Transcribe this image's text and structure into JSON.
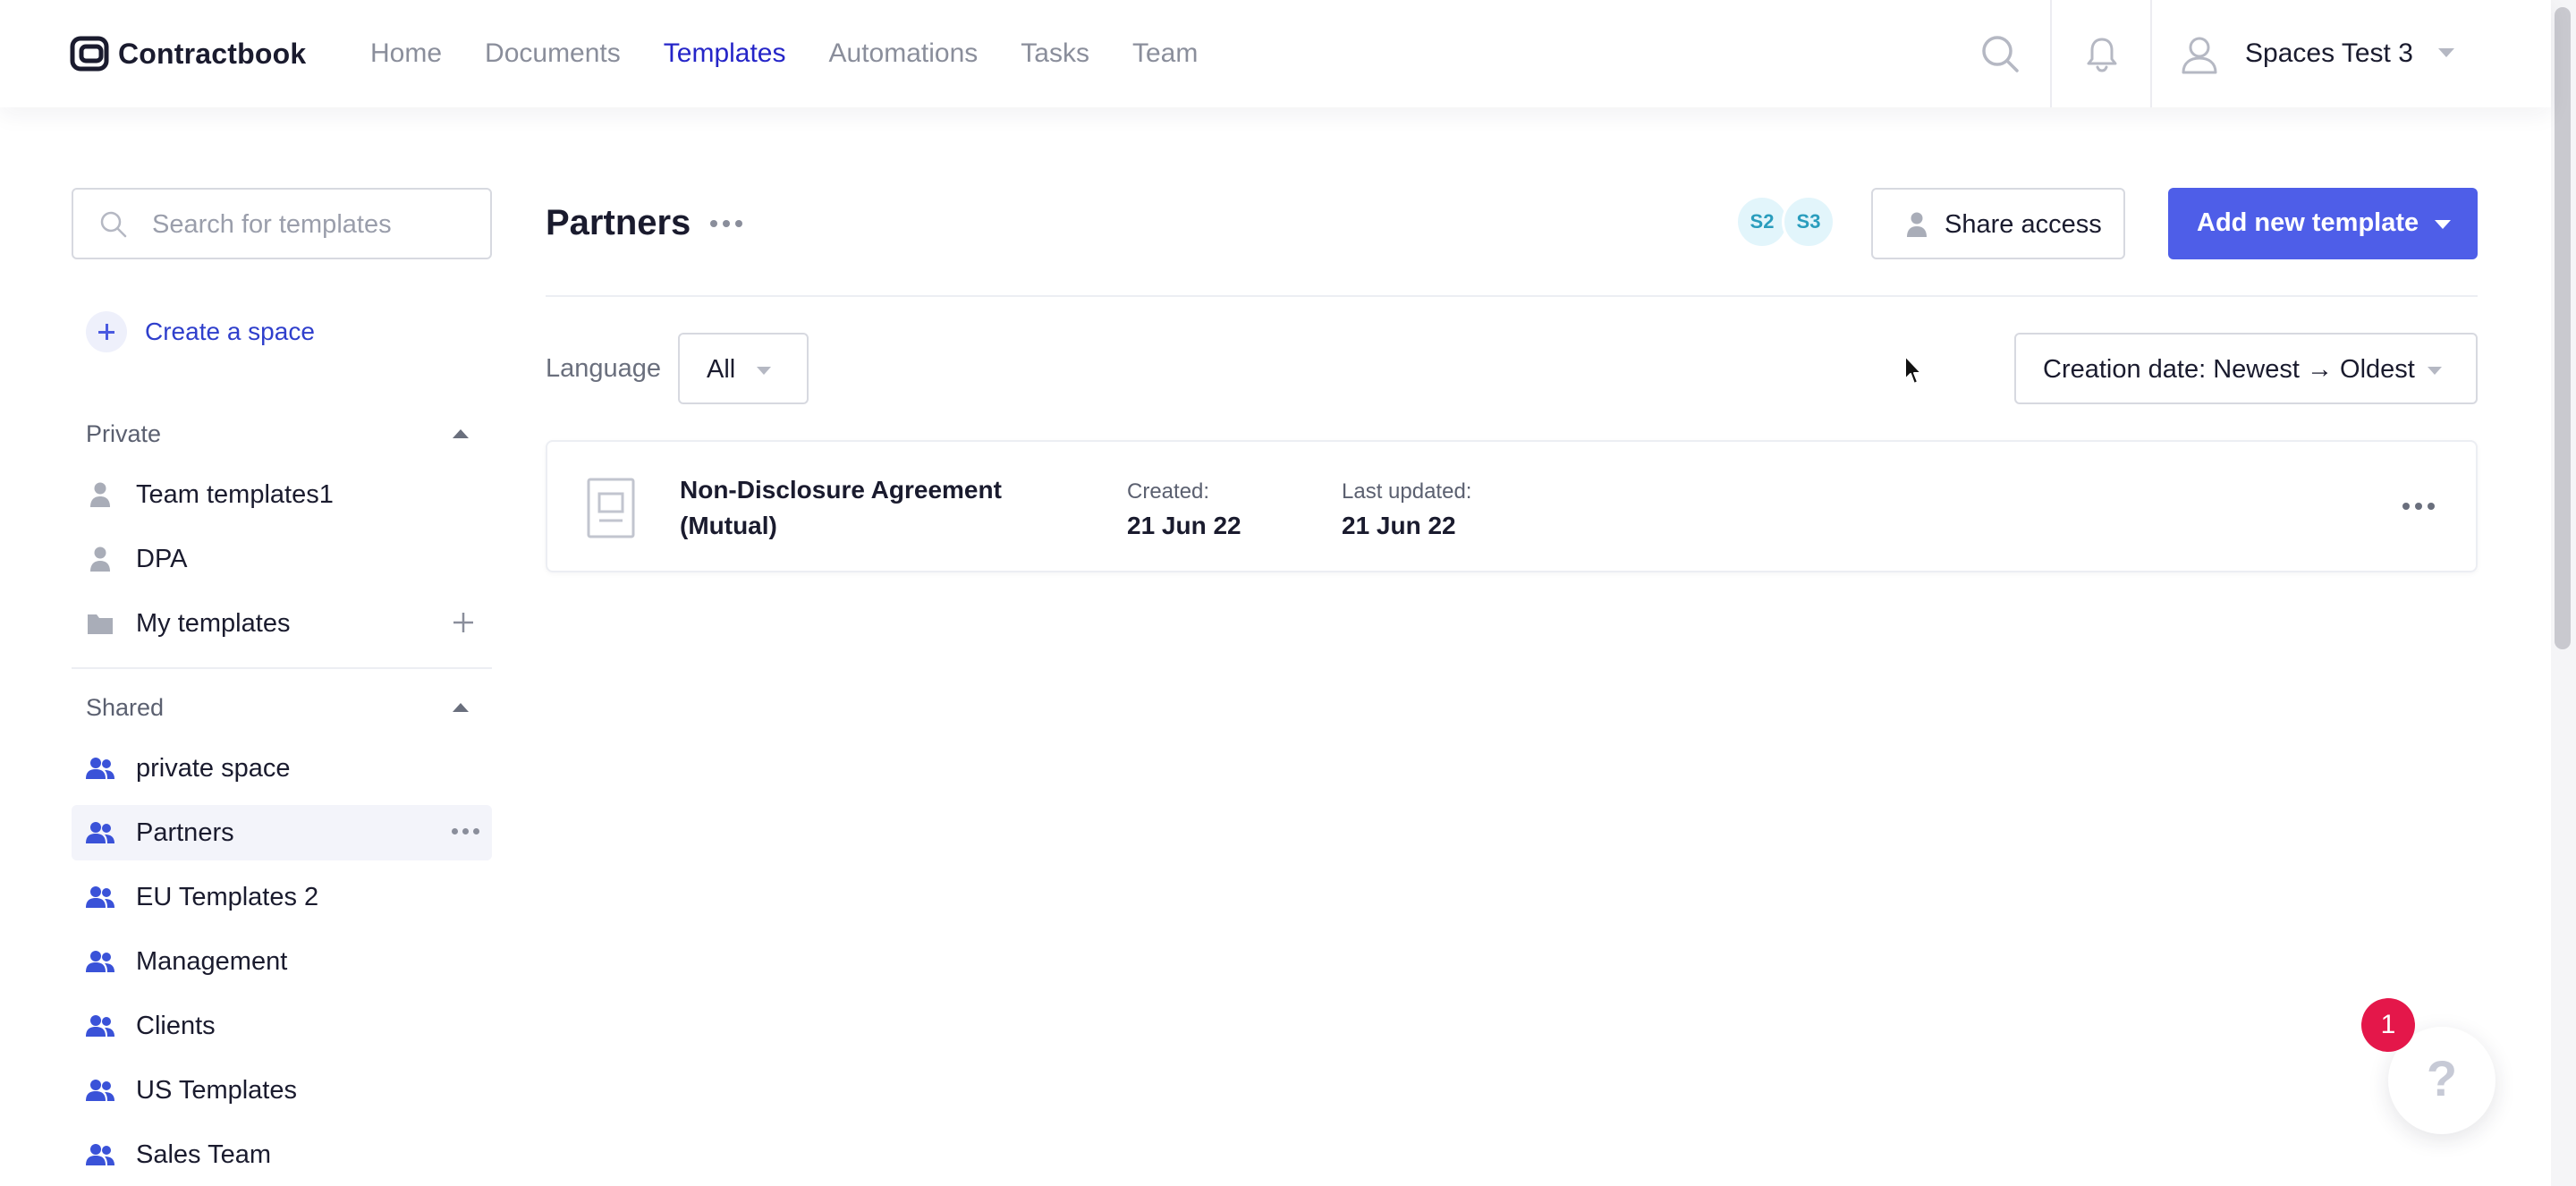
{
  "brand": {
    "name": "Contractbook"
  },
  "nav": {
    "items": [
      {
        "label": "Home",
        "active": false
      },
      {
        "label": "Documents",
        "active": false
      },
      {
        "label": "Templates",
        "active": true
      },
      {
        "label": "Automations",
        "active": false
      },
      {
        "label": "Tasks",
        "active": false
      },
      {
        "label": "Team",
        "active": false
      }
    ]
  },
  "user": {
    "name": "Spaces Test 3"
  },
  "sidebar": {
    "search_placeholder": "Search for templates",
    "create_space_label": "Create a space",
    "private": {
      "heading": "Private",
      "items": [
        {
          "label": "Team templates1",
          "icon": "person-icon"
        },
        {
          "label": "DPA",
          "icon": "person-icon"
        },
        {
          "label": "My templates",
          "icon": "folder-icon"
        }
      ]
    },
    "shared": {
      "heading": "Shared",
      "items": [
        {
          "label": "private space",
          "icon": "group-icon"
        },
        {
          "label": "Partners",
          "icon": "group-icon",
          "selected": true
        },
        {
          "label": "EU Templates 2",
          "icon": "group-icon"
        },
        {
          "label": "Management",
          "icon": "group-icon"
        },
        {
          "label": "Clients",
          "icon": "group-icon"
        },
        {
          "label": "US Templates",
          "icon": "group-icon"
        },
        {
          "label": "Sales Team",
          "icon": "group-icon"
        }
      ]
    }
  },
  "main": {
    "title": "Partners",
    "avatars": [
      "S2",
      "S3"
    ],
    "share_label": "Share access",
    "add_label": "Add new template",
    "language_label": "Language",
    "language_value": "All",
    "sort_value": "Creation date: Newest → Oldest",
    "templates": [
      {
        "title": "Non-Disclosure Agreement (Mutual)",
        "created_label": "Created:",
        "created_value": "21 Jun 22",
        "updated_label": "Last updated:",
        "updated_value": "21 Jun 22"
      }
    ]
  },
  "help": {
    "label": "?",
    "badge": "1"
  },
  "colors": {
    "accent": "#4e5ee8",
    "nav_active": "#2525c8",
    "badge": "#e4174a",
    "avatar_text": "#2a9dbd"
  }
}
